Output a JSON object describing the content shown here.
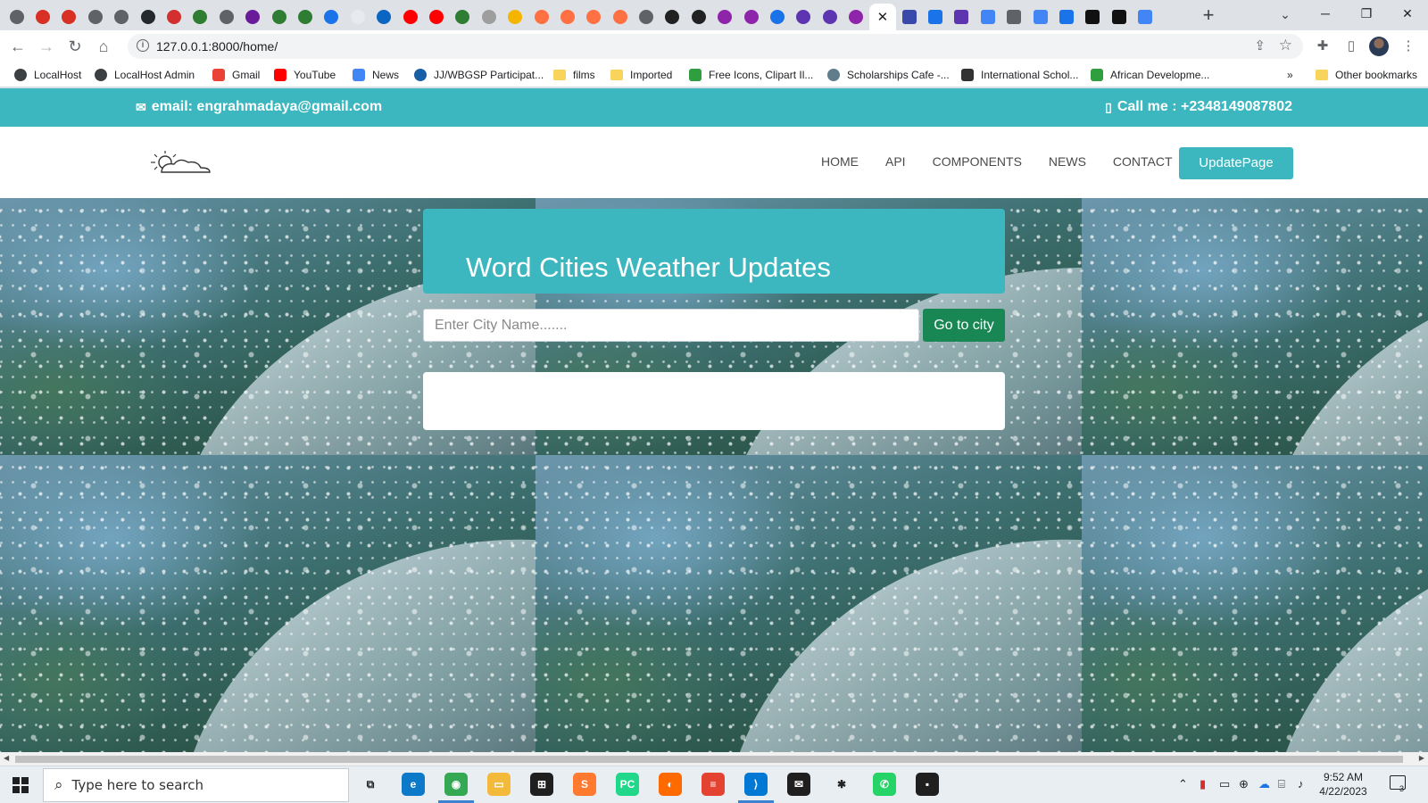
{
  "browser": {
    "tab_favicons": [
      "#5f6368",
      "#d93025",
      "#d93025",
      "#5f6368",
      "#5f6368",
      "#24292e",
      "#d32f2f",
      "#2e7d32",
      "#5f6368",
      "#6a1b9a",
      "#2e7d32",
      "#2e7d32",
      "#1a73e8",
      "#e8eaed",
      "#0a66c2",
      "#ff0000",
      "#ff0000",
      "#2e7d32",
      "#9e9e9e",
      "#f4b400",
      "#ff7043",
      "#ff7043",
      "#ff7043",
      "#ff7043",
      "#5f6368",
      "#212121",
      "#212121",
      "#8e24aa",
      "#8e24aa",
      "#1a73e8",
      "#5e35b1",
      "#5e35b1",
      "#8e24aa"
    ],
    "active_tab_close": "✕",
    "tab_favicons_after": [
      "#3949ab",
      "#1a73e8",
      "#5e35b1",
      "#4285f4",
      "#5f6368",
      "#4285f4",
      "#1a73e8",
      "#111111",
      "#111111",
      "#4285f4"
    ],
    "new_tab_label": "+",
    "url": "127.0.0.1:8000/home/",
    "bookmarks": [
      {
        "label": "LocalHost",
        "color": "#3c4043",
        "shape": "round"
      },
      {
        "label": "LocalHost Admin",
        "color": "#3c4043",
        "shape": "round"
      },
      {
        "label": "Gmail",
        "color": "#ea4335",
        "shape": "square"
      },
      {
        "label": "YouTube",
        "color": "#ff0000",
        "shape": "square"
      },
      {
        "label": "News",
        "color": "#4285f4",
        "shape": "square"
      },
      {
        "label": "JJ/WBGSP Participat...",
        "color": "#1a5ea8",
        "shape": "round"
      },
      {
        "label": "films",
        "color": "#f9d45c",
        "shape": "folder"
      },
      {
        "label": "Imported",
        "color": "#f9d45c",
        "shape": "folder"
      },
      {
        "label": "Free Icons, Clipart Il...",
        "color": "#2e9e3e",
        "shape": "square"
      },
      {
        "label": "Scholarships Cafe -...",
        "color": "#607d8b",
        "shape": "round"
      },
      {
        "label": "International Schol...",
        "color": "#333333",
        "shape": "square"
      },
      {
        "label": "African Developme...",
        "color": "#2e9e3e",
        "shape": "square"
      }
    ],
    "bookmarks_overflow": "»",
    "other_bookmarks": "Other bookmarks"
  },
  "page": {
    "topbar": {
      "email": "email: engrahmadaya@gmail.com",
      "phone": "Call me : +2348149087802"
    },
    "nav": {
      "links": [
        "HOME",
        "API",
        "COMPONENTS",
        "NEWS",
        "CONTACT"
      ],
      "update_button": "UpdatePage"
    },
    "heading": "Word Cities Weather Updates",
    "search": {
      "placeholder": "Enter City Name.......",
      "value": "",
      "button": "Go to city"
    },
    "colors": {
      "accent": "#3cb7bf",
      "go_button": "#198754"
    }
  },
  "taskbar": {
    "search_placeholder": "Type here to search",
    "apps": [
      {
        "name": "task-view",
        "color": "#e9eef3",
        "glyph": "⧉"
      },
      {
        "name": "edge",
        "color": "#0c7ac9",
        "glyph": "e"
      },
      {
        "name": "chrome",
        "color": "#34a853",
        "glyph": "◉"
      },
      {
        "name": "file-explorer",
        "color": "#f2b93b",
        "glyph": "▭"
      },
      {
        "name": "store",
        "color": "#1f1f1f",
        "glyph": "⊞"
      },
      {
        "name": "sublime-text",
        "color": "#ff7a2f",
        "glyph": "S"
      },
      {
        "name": "pycharm",
        "color": "#21d789",
        "glyph": "PC"
      },
      {
        "name": "firefox",
        "color": "#ff6a00",
        "glyph": "◐"
      },
      {
        "name": "todoist",
        "color": "#e44332",
        "glyph": "≡"
      },
      {
        "name": "vscode",
        "color": "#0078d4",
        "glyph": "⟩"
      },
      {
        "name": "mail",
        "color": "#1f1f1f",
        "glyph": "✉"
      },
      {
        "name": "slack",
        "color": "#e9eef3",
        "glyph": "✱"
      },
      {
        "name": "whatsapp",
        "color": "#25d366",
        "glyph": "✆"
      },
      {
        "name": "sticky-app",
        "color": "#1f1f1f",
        "glyph": "▪"
      }
    ],
    "time": "9:52 AM",
    "date": "4/22/2023",
    "notifications": "3"
  }
}
